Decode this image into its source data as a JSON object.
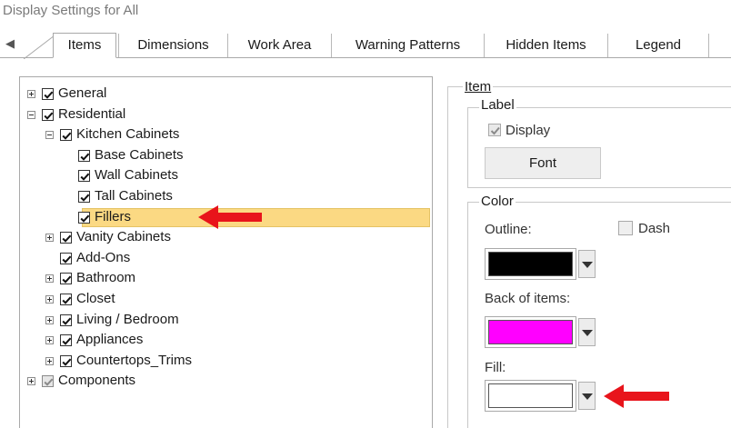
{
  "window": {
    "title": "Display Settings for All"
  },
  "tabs": [
    {
      "label": "Items",
      "active": true
    },
    {
      "label": "Dimensions",
      "active": false
    },
    {
      "label": "Work Area",
      "active": false
    },
    {
      "label": "Warning Patterns",
      "active": false
    },
    {
      "label": "Hidden Items",
      "active": false
    },
    {
      "label": "Legend",
      "active": false
    }
  ],
  "tree": {
    "items": [
      {
        "label": "General",
        "expander": "plus",
        "checked": true
      },
      {
        "label": "Residential",
        "expander": "minus",
        "checked": true
      },
      {
        "label": "Kitchen Cabinets",
        "expander": "minus",
        "checked": true
      },
      {
        "label": "Base Cabinets",
        "expander": "none",
        "checked": true
      },
      {
        "label": "Wall Cabinets",
        "expander": "none",
        "checked": true
      },
      {
        "label": "Tall Cabinets",
        "expander": "none",
        "checked": true
      },
      {
        "label": "Fillers",
        "expander": "none",
        "checked": true,
        "selected": true
      },
      {
        "label": "Vanity Cabinets",
        "expander": "plus",
        "checked": true
      },
      {
        "label": "Add-Ons",
        "expander": "none",
        "checked": true
      },
      {
        "label": "Bathroom",
        "expander": "plus",
        "checked": true
      },
      {
        "label": "Closet",
        "expander": "plus",
        "checked": true
      },
      {
        "label": "Living / Bedroom",
        "expander": "plus",
        "checked": true
      },
      {
        "label": "Appliances",
        "expander": "plus",
        "checked": true
      },
      {
        "label": "Countertops_Trims",
        "expander": "plus",
        "checked": true
      },
      {
        "label": "Components",
        "expander": "plus",
        "checked": true,
        "greyed": true
      }
    ]
  },
  "item_group": {
    "title": "Item",
    "label_group": {
      "title": "Label",
      "display_label": "Display",
      "display_checked": true,
      "font_button": "Font"
    },
    "color_group": {
      "title": "Color",
      "outline_label": "Outline:",
      "outline_color": "#000000",
      "dash_label": "Dash",
      "dash_checked": false,
      "back_label": "Back of items:",
      "back_color": "#ff00ff",
      "fill_label": "Fill:",
      "fill_color": "#ffffff"
    }
  },
  "annotations": {
    "arrow_color": "#e8141b"
  }
}
